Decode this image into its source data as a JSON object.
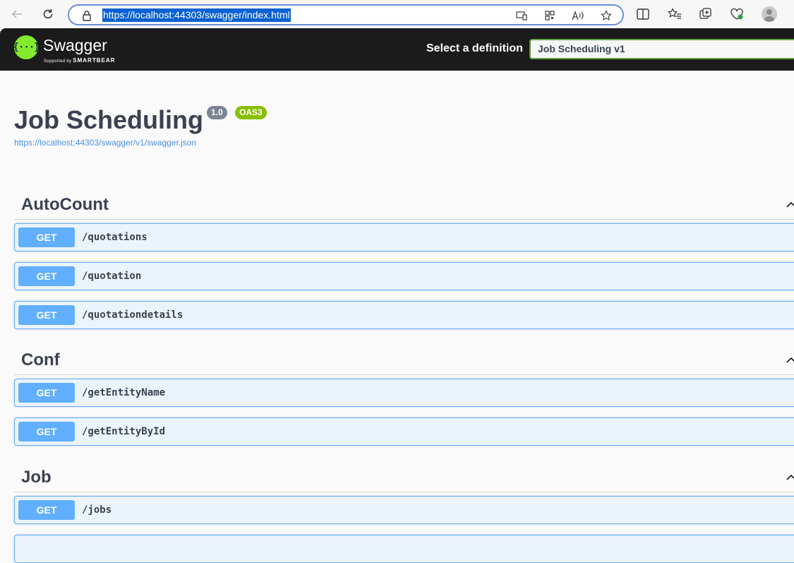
{
  "browser": {
    "url": "https://localhost:44303/swagger/index.html"
  },
  "topbar": {
    "logo_symbol": "{···}",
    "logo_text": "Swagger",
    "logo_sub_prefix": "Supported by",
    "logo_sub_brand": "SMARTBEAR",
    "definition_label": "Select a definition",
    "definition_value": "Job Scheduling v1"
  },
  "info": {
    "title": "Job Scheduling",
    "version": "1.0",
    "oas": "OAS3",
    "spec_url": "https://localhost:44303/swagger/v1/swagger.json"
  },
  "tags": [
    {
      "name": "AutoCount",
      "operations": [
        {
          "method": "GET",
          "path": "/quotations"
        },
        {
          "method": "GET",
          "path": "/quotation"
        },
        {
          "method": "GET",
          "path": "/quotationdetails"
        }
      ]
    },
    {
      "name": "Conf",
      "operations": [
        {
          "method": "GET",
          "path": "/getEntityName"
        },
        {
          "method": "GET",
          "path": "/getEntityById"
        }
      ]
    },
    {
      "name": "Job",
      "operations": [
        {
          "method": "GET",
          "path": "/jobs"
        }
      ]
    }
  ],
  "colors": {
    "get_method": "#61affe",
    "get_bg": "#ebf3fb",
    "swagger_green": "#85ea2d",
    "oas_badge": "#89bf04",
    "version_badge": "#7d8492",
    "topbar_bg": "#1b1b1b"
  }
}
